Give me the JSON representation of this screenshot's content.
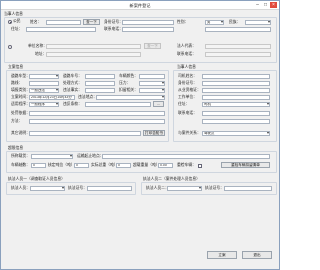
{
  "window": {
    "title": "新案件登记",
    "minimize": "–",
    "maximize": "□",
    "close": "×"
  },
  "party": {
    "section": "当事人信息",
    "type_company": "公民",
    "name_label": "姓名：",
    "lookup_button": "查一下",
    "id_label": "身份证号：",
    "gender_label": "性别：",
    "gender_value": "男",
    "ethnicity_label": "民族：",
    "address_label": "住址：",
    "phone_label": "联系电话：",
    "unit_name_label": "单位名称：",
    "unit_address_label": "地址：",
    "unit_lookup_button": "查一下",
    "legal_rep_label": "法人代表：",
    "unit_phone_label": "联系电话："
  },
  "case": {
    "section": "立案信息",
    "vehicle_label": "道路车型：",
    "plate_label": "道路车号：",
    "vehicle_color_label": "车辆颜色：",
    "route_label": "路线：",
    "handling_label": "处理方式：",
    "pressure_label": "压力：",
    "method_label": "方法：",
    "category_label": "填报类别：",
    "category_value": "一般违法",
    "violation_label": "违法事实：",
    "detain_label": "扣留相关：",
    "record_time_label": "立案时间：",
    "record_time_value": "2013年12月23日14时43分",
    "place_label": "违法地点：",
    "applicable_label": "适用程序：",
    "applicable_value": "一般程序",
    "law_label": "违反条款：",
    "more_button": "...",
    "penalty_label": "处罚依据：",
    "other_label": "其它说明：",
    "print_button": "打印告知书"
  },
  "handler": {
    "section": "当事人信息",
    "role_label": "司机姓名：",
    "id_label": "身份证号：",
    "license_label": "从业资格证：",
    "workplace_label": "工作单位：",
    "address_label": "住址：",
    "address_value": "司机",
    "phone_label": "联系电话：",
    "relation_label": "与案件关系：",
    "relation_value": "驾驶员"
  },
  "cargo": {
    "section": "超限信息",
    "goods_label": "所称载货：",
    "start_label": "运输起止地点：",
    "axle_label": "车辆轴数：",
    "axle_value": "0",
    "rated_label": "核定吨位（吨）：",
    "rated_value": "0",
    "actual_label": "实际总重（吨）：",
    "actual_value": "0",
    "over_label": "超载重量（吨）：",
    "over_value": "0.00",
    "check_label": "重检车辆：",
    "check_button": "重检车辆扣留清单"
  },
  "officers": {
    "section_a": "执法人员一（调查取证人员信息）",
    "officer_a_name": "执法人员：",
    "officer_a_card": "执法证号：",
    "section_b": "执法人员二（案件处理人员信息）",
    "officer_b_name": "执法人员二：",
    "officer_b_card": "执法证号："
  },
  "footer": {
    "register_button": "立案",
    "cancel_button": "退出"
  },
  "colors": {
    "accent": "#2b5fa8",
    "close": "#e14a3c"
  }
}
